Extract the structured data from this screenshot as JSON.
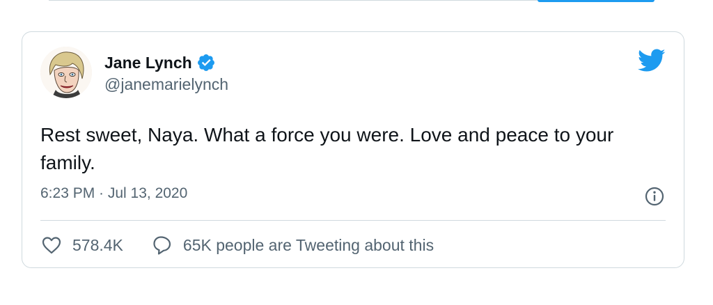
{
  "tweet": {
    "author": {
      "display_name": "Jane Lynch",
      "handle": "@janemarielynch",
      "verified": true,
      "avatar_icon": "caricature-avatar"
    },
    "text": "Rest sweet, Naya. What a force you were. Love and peace to your family.",
    "timestamp": "6:23 PM · Jul 13, 2020",
    "likes": "578.4K",
    "conversation": "65K people are Tweeting about this"
  },
  "colors": {
    "brand_blue": "#1d9bf0",
    "secondary_text": "#536471",
    "border": "#cfd9de"
  },
  "icons": {
    "brand": "twitter-bird-icon",
    "info": "info-icon",
    "like": "heart-icon",
    "reply": "speech-bubble-icon",
    "verified": "verified-badge-icon"
  }
}
